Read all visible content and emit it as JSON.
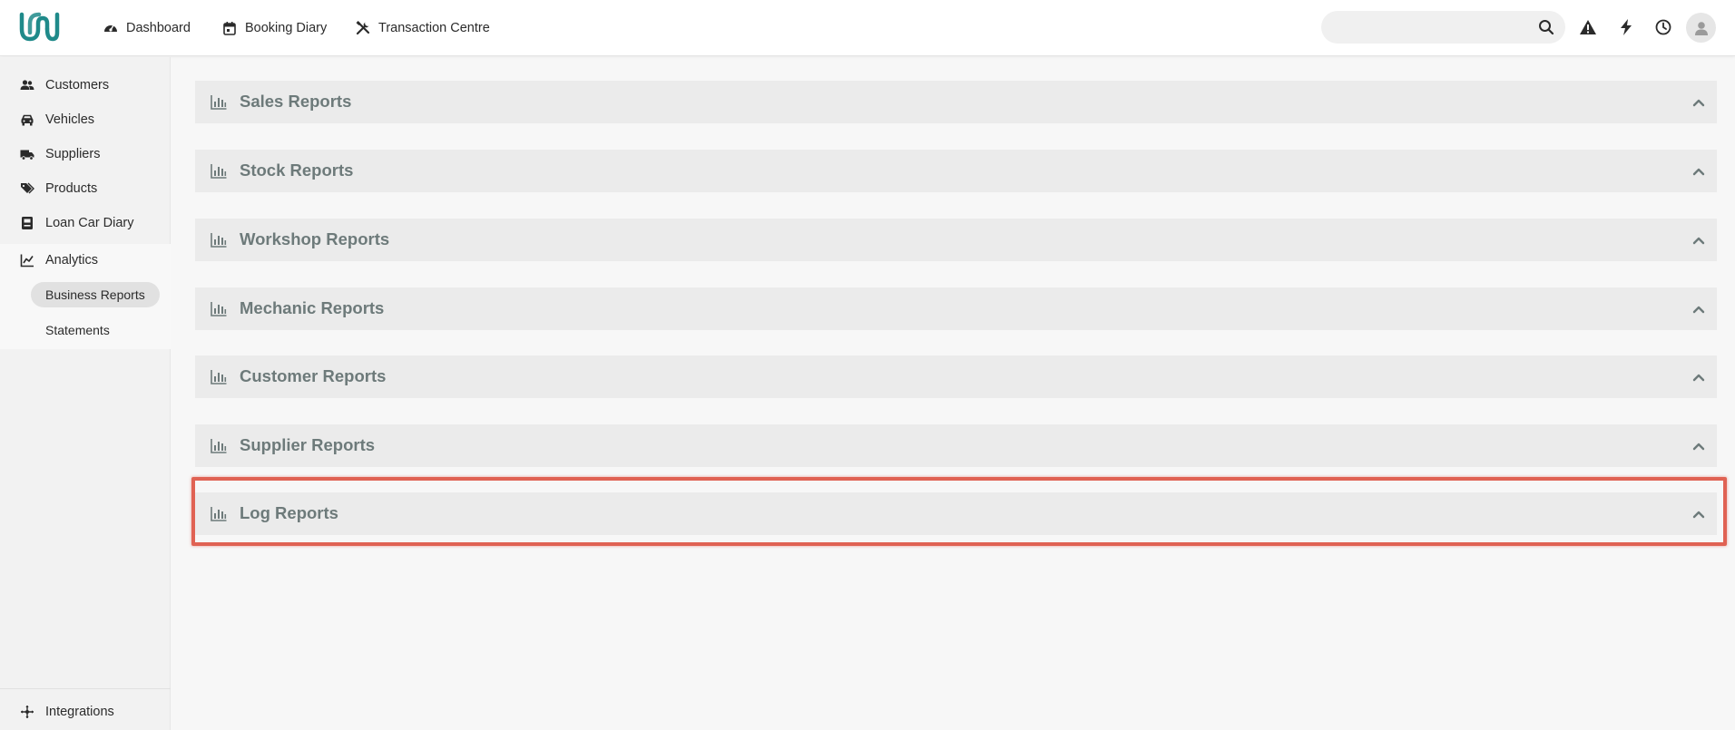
{
  "topnav": {
    "items": [
      {
        "label": "Dashboard",
        "icon": "gauge-icon"
      },
      {
        "label": "Booking Diary",
        "icon": "calendar-icon"
      },
      {
        "label": "Transaction Centre",
        "icon": "tools-icon"
      }
    ],
    "search_placeholder": ""
  },
  "sidebar": {
    "items": [
      {
        "label": "Customers",
        "icon": "users-icon"
      },
      {
        "label": "Vehicles",
        "icon": "car-icon"
      },
      {
        "label": "Suppliers",
        "icon": "truck-icon"
      },
      {
        "label": "Products",
        "icon": "tags-icon"
      },
      {
        "label": "Loan Car Diary",
        "icon": "diary-icon"
      },
      {
        "label": "Analytics",
        "icon": "chart-line-icon"
      }
    ],
    "analytics_sub": [
      {
        "label": "Business Reports",
        "active": true
      },
      {
        "label": "Statements",
        "active": false
      }
    ],
    "footer": {
      "label": "Integrations",
      "icon": "integrations-icon"
    }
  },
  "reports": [
    {
      "title": "Sales Reports"
    },
    {
      "title": "Stock Reports"
    },
    {
      "title": "Workshop Reports"
    },
    {
      "title": "Mechanic Reports"
    },
    {
      "title": "Customer Reports"
    },
    {
      "title": "Supplier Reports"
    },
    {
      "title": "Log Reports",
      "highlighted": true
    }
  ],
  "colors": {
    "brand": "#1f8a8a",
    "panel_bg": "#ebebeb",
    "panel_title": "#6d7a7a",
    "highlight": "#e06253"
  }
}
